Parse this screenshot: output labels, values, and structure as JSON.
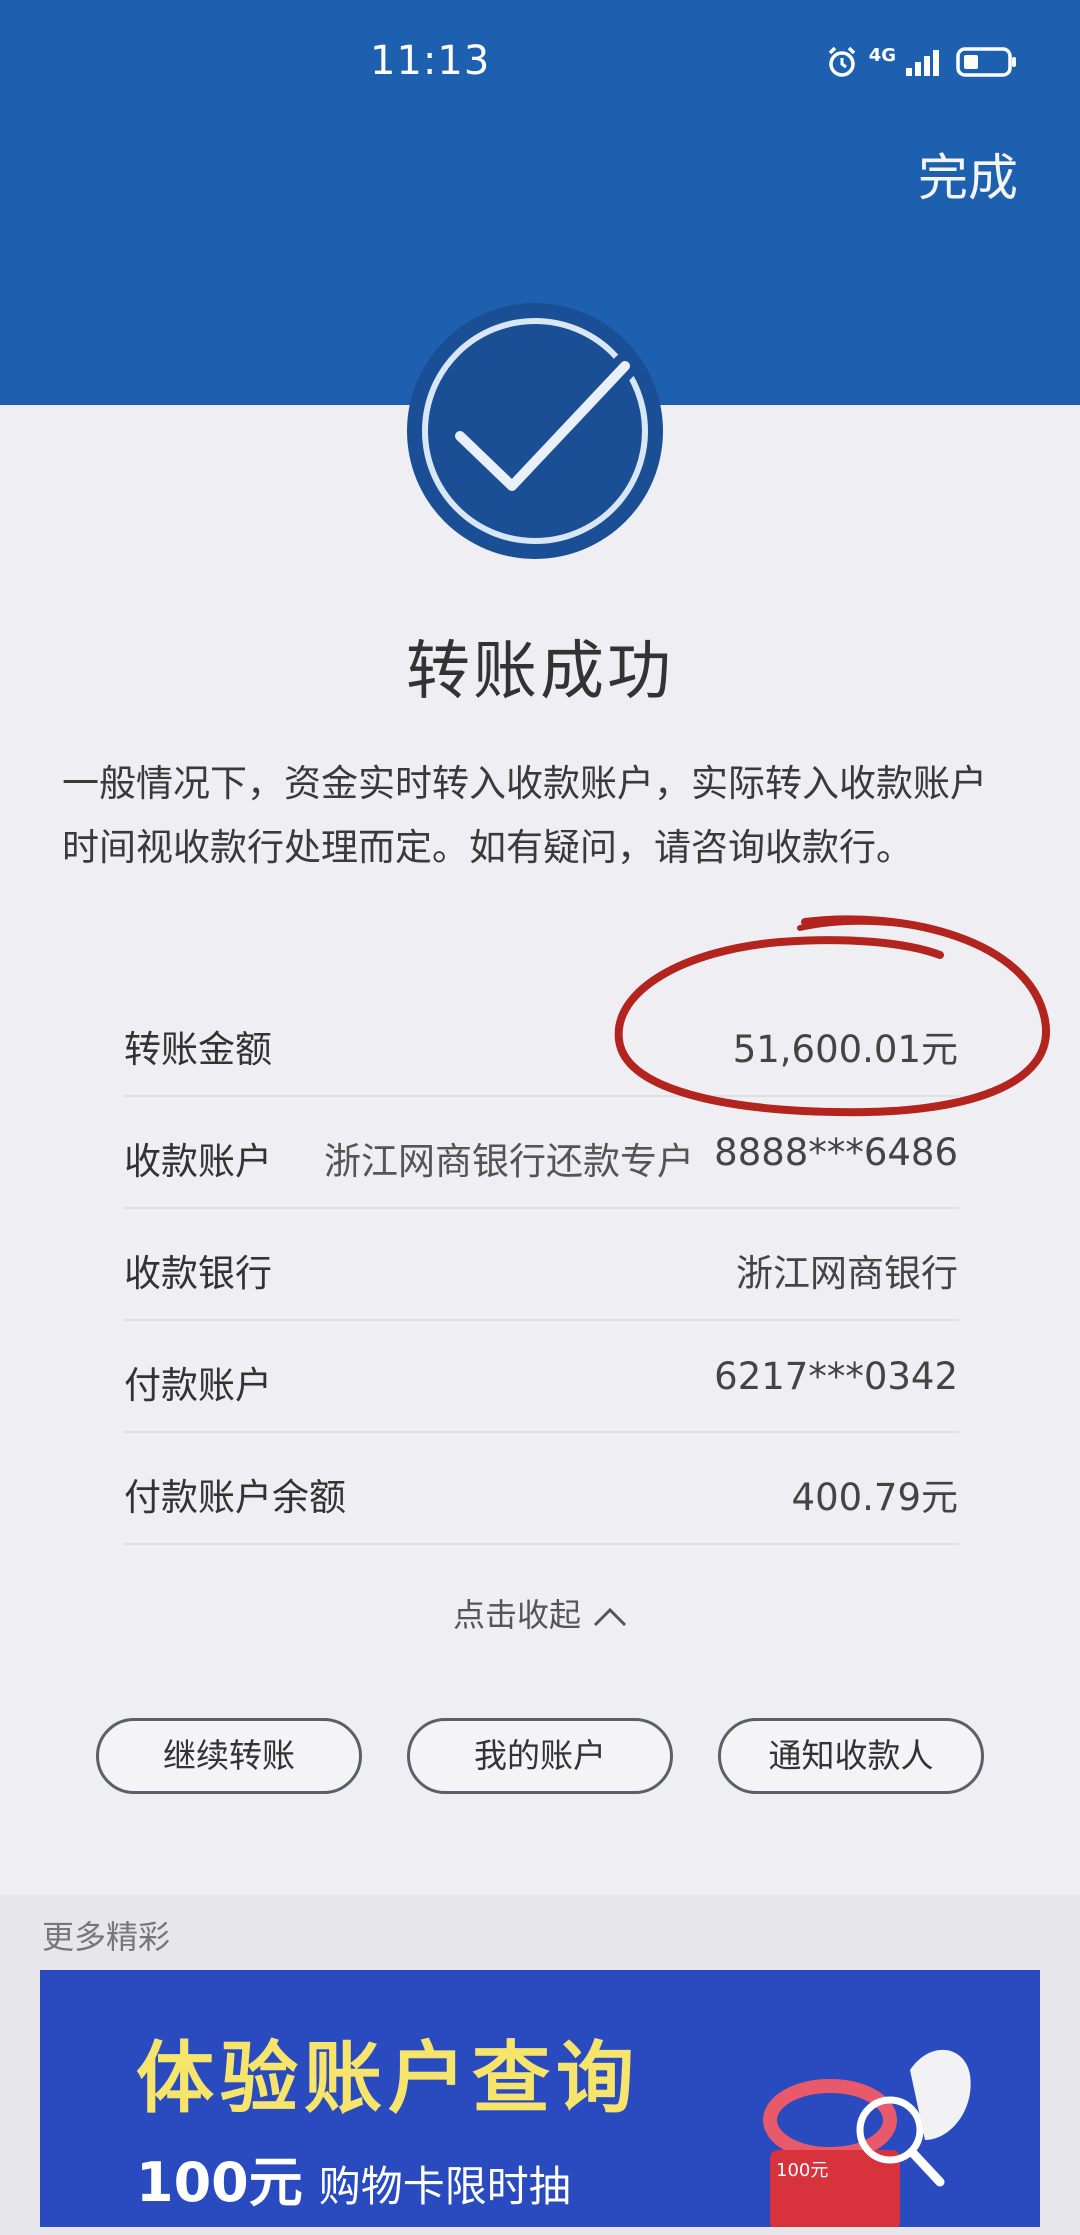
{
  "status_bar": {
    "time": "11:13",
    "network": "4G"
  },
  "header": {
    "done_label": "完成"
  },
  "result": {
    "title": "转账成功",
    "notice": "一般情况下，资金实时转入收款账户，实际转入收款账户时间视收款行处理而定。如有疑问，请咨询收款行。"
  },
  "details": [
    {
      "label": "转账金额",
      "middle": "",
      "value": "51,600.01元"
    },
    {
      "label": "收款账户",
      "middle": "浙江网商银行还款专户",
      "value": "8888***6486"
    },
    {
      "label": "收款银行",
      "middle": "",
      "value": "浙江网商银行"
    },
    {
      "label": "付款账户",
      "middle": "",
      "value": "6217***0342"
    },
    {
      "label": "付款账户余额",
      "middle": "",
      "value": "400.79元"
    }
  ],
  "collapse_label": "点击收起",
  "actions": {
    "continue_label": "继续转账",
    "my_account_label": "我的账户",
    "notify_label": "通知收款人"
  },
  "more": {
    "section_label": "更多精彩",
    "banner_title": "体验账户查询",
    "banner_amount": "100元",
    "banner_sub": "购物卡限时抽",
    "banner_badge": "100元"
  },
  "colors": {
    "header_blue": "#1e60b0",
    "check_navy": "#1a4f96",
    "annotation_red": "#b3241e"
  }
}
